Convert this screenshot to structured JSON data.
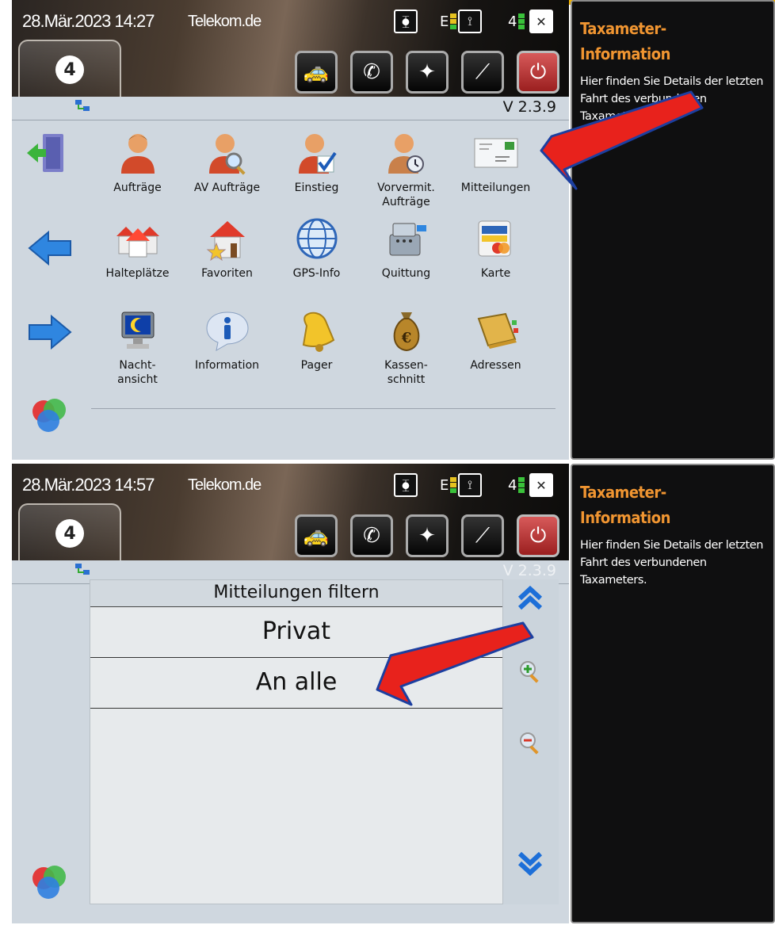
{
  "screen1": {
    "status": {
      "datetime": "28.Mär.2023 14:27",
      "provider": "Telekom.de",
      "net_label": "E",
      "sat_count": "4"
    },
    "version": "V 2.3.9",
    "menu": [
      [
        "Aufträge",
        "AV Aufträge",
        "Einstieg",
        "Vorvermit. Aufträge",
        "Mitteilungen"
      ],
      [
        "Halteplätze",
        "Favoriten",
        "GPS-Info",
        "Quittung",
        "Karte"
      ],
      [
        "Nacht- ansicht",
        "Information",
        "Pager",
        "Kassen- schnitt",
        "Adressen"
      ]
    ],
    "menu_labels": {
      "r1c1": "Aufträge",
      "r1c2": "AV Aufträge",
      "r1c3": "Einstieg",
      "r1c4a": "Vorvermit.",
      "r1c4b": "Aufträge",
      "r1c5": "Mitteilungen",
      "r2c1": "Halteplätze",
      "r2c2": "Favoriten",
      "r2c3": "GPS-Info",
      "r2c4": "Quittung",
      "r2c5": "Karte",
      "r3c1a": "Nacht-",
      "r3c1b": "ansicht",
      "r3c2": "Information",
      "r3c3": "Pager",
      "r3c4a": "Kassen-",
      "r3c4b": "schnitt",
      "r3c5": "Adressen"
    },
    "sidebar": {
      "title_1": "Taxameter-",
      "title_2": "Information",
      "body": "Hier finden Sie Details der letzten Fahrt des verbundenen Taxameters."
    }
  },
  "screen2": {
    "status": {
      "datetime": "28.Mär.2023 14:57",
      "provider": "Telekom.de",
      "net_label": "E",
      "sat_count": "4"
    },
    "version": "V 2.3.9",
    "filter": {
      "title": "Mitteilungen filtern",
      "items": [
        "Privat",
        "An alle"
      ]
    },
    "sidebar": {
      "title_1": "Taxameter-",
      "title_2": "Information",
      "body": "Hier finden Sie Details der letzten Fahrt des verbundenen Taxameters."
    }
  },
  "colors": {
    "accent_orange": "#f09531",
    "panel": "#cfd7df",
    "annotation_arrow": "#e8221c",
    "sidebar_bg": "#0f0f10"
  }
}
